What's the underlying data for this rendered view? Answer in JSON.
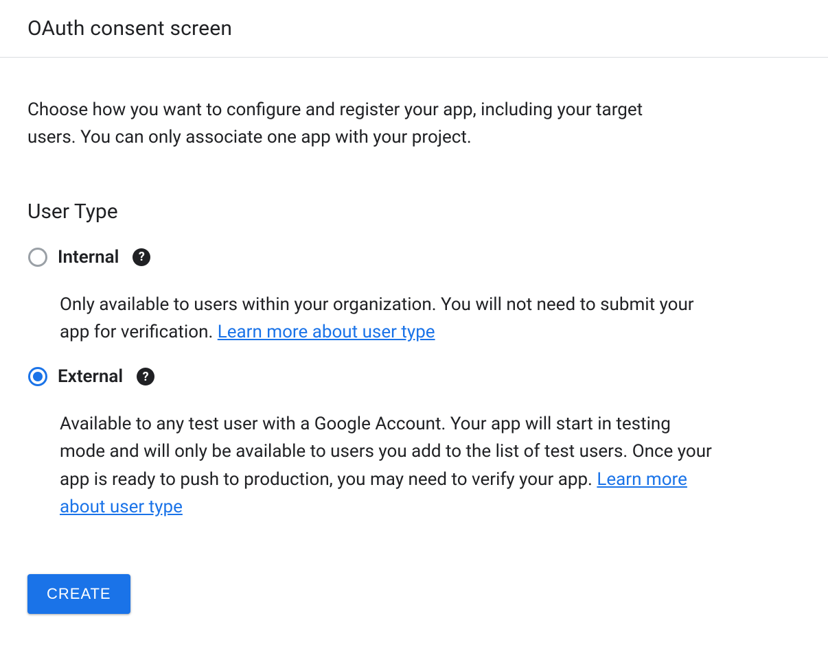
{
  "header": {
    "title": "OAuth consent screen"
  },
  "intro": {
    "text": "Choose how you want to configure and register your app, including your target users. You can only associate one app with your project."
  },
  "user_type": {
    "heading": "User Type",
    "options": [
      {
        "label": "Internal",
        "selected": false,
        "description": "Only available to users within your organization. You will not need to submit your app for verification. ",
        "link_text": "Learn more about user type"
      },
      {
        "label": "External",
        "selected": true,
        "description": "Available to any test user with a Google Account. Your app will start in testing mode and will only be available to users you add to the list of test users. Once your app is ready to push to production, you may need to verify your app. ",
        "link_text": "Learn more about user type"
      }
    ]
  },
  "actions": {
    "create_label": "CREATE"
  },
  "icons": {
    "help": "?"
  }
}
